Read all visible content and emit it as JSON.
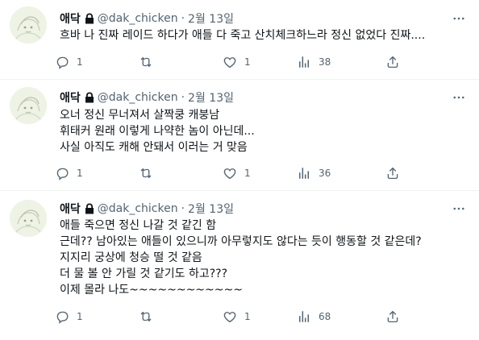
{
  "tweets": [
    {
      "author": "애닥",
      "handle": "@dak_chicken",
      "dot": "·",
      "date": "2월 13일",
      "lines": [
        "흐바 나 진짜 레이드 하다가 애들 다 죽고 산치체크하느라 정신 없었다 진짜...."
      ],
      "replies": "1",
      "retweets": "",
      "likes": "1",
      "views": "38"
    },
    {
      "author": "애닥",
      "handle": "@dak_chicken",
      "dot": "·",
      "date": "2월 13일",
      "lines": [
        "오너 정신 무너져서 살짝쿵 캐붕남",
        "휘태커 원래 이렇게 나약한 놈이 아닌데...",
        "사실 아직도 캐해 안돼서 이러는 거 맞음"
      ],
      "replies": "1",
      "retweets": "",
      "likes": "1",
      "views": "36"
    },
    {
      "author": "애닥",
      "handle": "@dak_chicken",
      "dot": "·",
      "date": "2월 13일",
      "lines": [
        "애들 죽으면 정신 나갈 것 같긴 함",
        "근데?? 남아있는 애들이 있으니까 아무렇지도 않다는 듯이 행동할 것 같은데?",
        "지지리 궁상에 청승 떨 것 같음",
        "더 물 볼 안 가릴 것 같기도 하고???",
        "이제 몰라 나도~~~~~~~~~~~~"
      ],
      "replies": "1",
      "retweets": "",
      "likes": "1",
      "views": "68"
    }
  ],
  "icons": {
    "avatar": "avatar-image",
    "lock": "lock-icon",
    "more": "more-icon",
    "reply": "reply-icon",
    "retweet": "retweet-icon",
    "like": "like-icon",
    "views": "views-icon",
    "share": "share-icon"
  },
  "colors": {
    "text": "#0f1419",
    "secondary": "#536471",
    "separator": "#eff3f4"
  }
}
